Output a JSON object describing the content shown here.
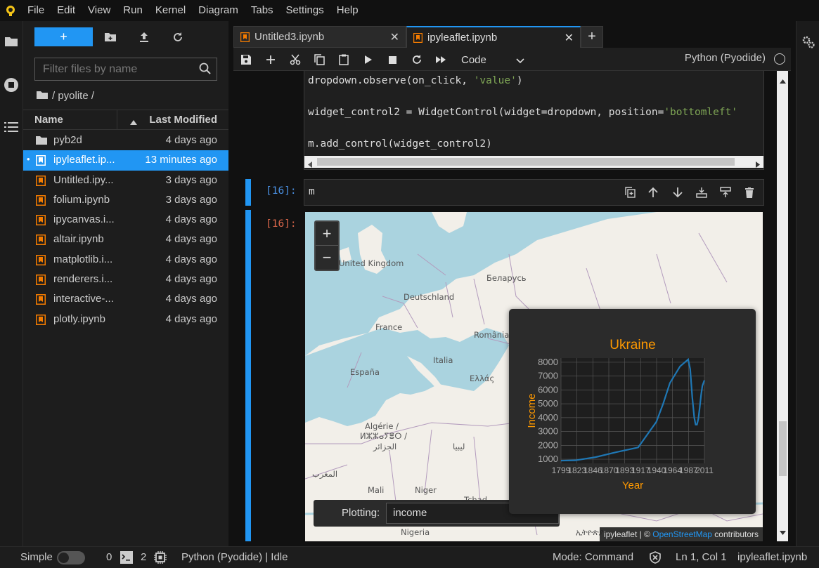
{
  "menu": [
    "File",
    "Edit",
    "View",
    "Run",
    "Kernel",
    "Diagram",
    "Tabs",
    "Settings",
    "Help"
  ],
  "filebrowser": {
    "new_label": "+",
    "filter_placeholder": "Filter files by name",
    "breadcrumb": "/ pyolite /",
    "col_name": "Name",
    "col_modified": "Last Modified",
    "items": [
      {
        "name": "pyb2d",
        "modified": "4 days ago",
        "type": "folder",
        "selected": false
      },
      {
        "name": "ipyleaflet.ip...",
        "modified": "13 minutes ago",
        "type": "notebook",
        "selected": true
      },
      {
        "name": "Untitled.ipy...",
        "modified": "3 days ago",
        "type": "notebook",
        "selected": false
      },
      {
        "name": "folium.ipynb",
        "modified": "3 days ago",
        "type": "notebook",
        "selected": false
      },
      {
        "name": "ipycanvas.i...",
        "modified": "4 days ago",
        "type": "notebook",
        "selected": false
      },
      {
        "name": "altair.ipynb",
        "modified": "4 days ago",
        "type": "notebook",
        "selected": false
      },
      {
        "name": "matplotlib.i...",
        "modified": "4 days ago",
        "type": "notebook",
        "selected": false
      },
      {
        "name": "renderers.i...",
        "modified": "4 days ago",
        "type": "notebook",
        "selected": false
      },
      {
        "name": "interactive-...",
        "modified": "4 days ago",
        "type": "notebook",
        "selected": false
      },
      {
        "name": "plotly.ipynb",
        "modified": "4 days ago",
        "type": "notebook",
        "selected": false
      }
    ]
  },
  "tabs": [
    {
      "label": "Untitled3.ipynb",
      "close": "✕"
    },
    {
      "label": "ipyleaflet.ipynb",
      "close": "✕"
    }
  ],
  "tab_add": "+",
  "notebook": {
    "cell_type": "Code",
    "kernel": "Python (Pyodide)",
    "code_lines": [
      {
        "pre": "dropdown.observe(on_click, ",
        "str": "'value'",
        "post": ")"
      },
      {
        "pre": "widget_control2 = WidgetControl(widget=dropdown, position=",
        "str": "'bottomleft'",
        "post": ""
      },
      {
        "pre": "m.add_control(widget_control2)",
        "str": "",
        "post": ""
      }
    ],
    "cell2_prompt": "[16]:",
    "cell2_code": "m",
    "out2_prompt": "[16]:"
  },
  "map": {
    "zoom_in": "+",
    "zoom_out": "−",
    "labels": [
      "United Kingdom",
      "Deutschland",
      "Беларусь",
      "France",
      "România",
      "España",
      "Italia",
      "Ελλάς",
      "Algérie /",
      "ⵍⵣⵣⴰⵢⴻⵔ /",
      "الجزائر",
      "ليبيا",
      "المغرب",
      "Mali",
      "Niger",
      "Tchad",
      "Nigeria",
      "ኢትዮጵያ"
    ],
    "control_label": "Plotting:",
    "control_value": "income",
    "attribution_pre": "ipyleaflet | © ",
    "attribution_link": "OpenStreetMap",
    "attribution_post": " contributors"
  },
  "chart_data": {
    "type": "line",
    "title": "Ukraine",
    "xlabel": "Year",
    "ylabel": "Income",
    "x_ticks": [
      "1799",
      "1823",
      "1846",
      "1870",
      "1893",
      "1917",
      "1940",
      "1964",
      "1987",
      "2011"
    ],
    "y_ticks": [
      1000,
      2000,
      3000,
      4000,
      5000,
      6000,
      7000,
      8000
    ],
    "xlim": [
      1799,
      2011
    ],
    "ylim": [
      700,
      8300
    ],
    "grid": true,
    "color": "#1f77b4",
    "title_color": "#ff9900",
    "series": [
      {
        "values": [
          [
            1799,
            900
          ],
          [
            1820,
            920
          ],
          [
            1850,
            1150
          ],
          [
            1880,
            1500
          ],
          [
            1913,
            1850
          ],
          [
            1940,
            3700
          ],
          [
            1950,
            5000
          ],
          [
            1960,
            6500
          ],
          [
            1975,
            7700
          ],
          [
            1987,
            8200
          ],
          [
            1990,
            7500
          ],
          [
            1993,
            5500
          ],
          [
            1996,
            4000
          ],
          [
            1998,
            3500
          ],
          [
            2000,
            3500
          ],
          [
            2002,
            3900
          ],
          [
            2004,
            4700
          ],
          [
            2006,
            5600
          ],
          [
            2008,
            6300
          ],
          [
            2011,
            6700
          ]
        ]
      }
    ]
  },
  "status": {
    "mode_label": "Simple",
    "terminals": "0",
    "kernels": "2",
    "kernel_status": "Python (Pyodide) | Idle",
    "mode": "Mode: Command",
    "position": "Ln 1, Col 1",
    "file": "ipyleaflet.ipynb"
  },
  "colors": {
    "accent": "#2196f3",
    "notebook_icon": "#f57c00",
    "prompt_in": "#4a90e2",
    "prompt_out": "#d9664a"
  }
}
